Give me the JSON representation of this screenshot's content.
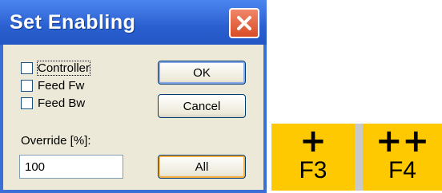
{
  "dialog": {
    "title": "Set Enabling",
    "checkboxes": [
      {
        "label": "Controller",
        "checked": false
      },
      {
        "label": "Feed Fw",
        "checked": false
      },
      {
        "label": "Feed Bw",
        "checked": false
      }
    ],
    "ok_label": "OK",
    "cancel_label": "Cancel",
    "override_label": "Override [%]:",
    "override_value": "100",
    "all_label": "All"
  },
  "function_keys": [
    {
      "symbol": "+",
      "label": "F3"
    },
    {
      "symbol": "++",
      "label": "F4"
    }
  ],
  "colors": {
    "titlebar": "#2a5fcf",
    "client_bg": "#ece9d8",
    "close_button": "#d94d26",
    "function_key": "#fec900"
  }
}
